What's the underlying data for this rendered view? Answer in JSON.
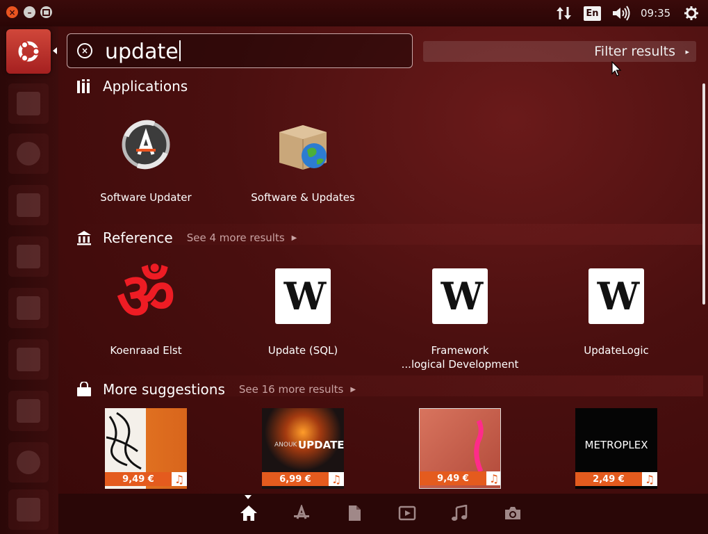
{
  "panel": {
    "keyboard_layout": "En",
    "clock": "09:35"
  },
  "search": {
    "query": "update",
    "clear_glyph": "×"
  },
  "filter": {
    "label": "Filter results",
    "arrow": "▸"
  },
  "categories": {
    "applications": {
      "title": "Applications",
      "icon": "applications-icon",
      "items": [
        {
          "label": "Software Updater",
          "icon": "software-updater-icon"
        },
        {
          "label": "Software & Updates",
          "icon": "software-sources-icon"
        }
      ]
    },
    "reference": {
      "title": "Reference",
      "icon": "reference-icon",
      "see_more": "See 4 more results",
      "items": [
        {
          "label": "Koenraad Elst",
          "icon": "om-icon"
        },
        {
          "label": "Update (SQL)",
          "icon": "wikipedia-icon",
          "glyph": "W"
        },
        {
          "label_line1": "Framework",
          "label_line2": "...logical Development",
          "icon": "wikipedia-icon",
          "glyph": "W"
        },
        {
          "label": "UpdateLogic",
          "icon": "wikipedia-icon",
          "glyph": "W"
        }
      ]
    },
    "suggestions": {
      "title": "More suggestions",
      "icon": "shopping-bag-icon",
      "see_more": "See 16 more results",
      "items": [
        {
          "price": "9,49 €",
          "cover_text": ""
        },
        {
          "price": "6,99 €",
          "cover_text": "UPDATE",
          "cover_small": "ANOUK"
        },
        {
          "price": "9,49 €",
          "cover_text": ""
        },
        {
          "price": "2,49 €",
          "cover_text": "METROPLEX"
        }
      ]
    }
  },
  "om_glyph": "ॐ",
  "music_glyph": "♫",
  "lenses": [
    {
      "name": "home-lens",
      "active": true
    },
    {
      "name": "applications-lens"
    },
    {
      "name": "files-lens"
    },
    {
      "name": "video-lens"
    },
    {
      "name": "music-lens"
    },
    {
      "name": "photos-lens"
    }
  ],
  "colors": {
    "accent": "#e95420",
    "price_strip": "#e45b1e"
  }
}
